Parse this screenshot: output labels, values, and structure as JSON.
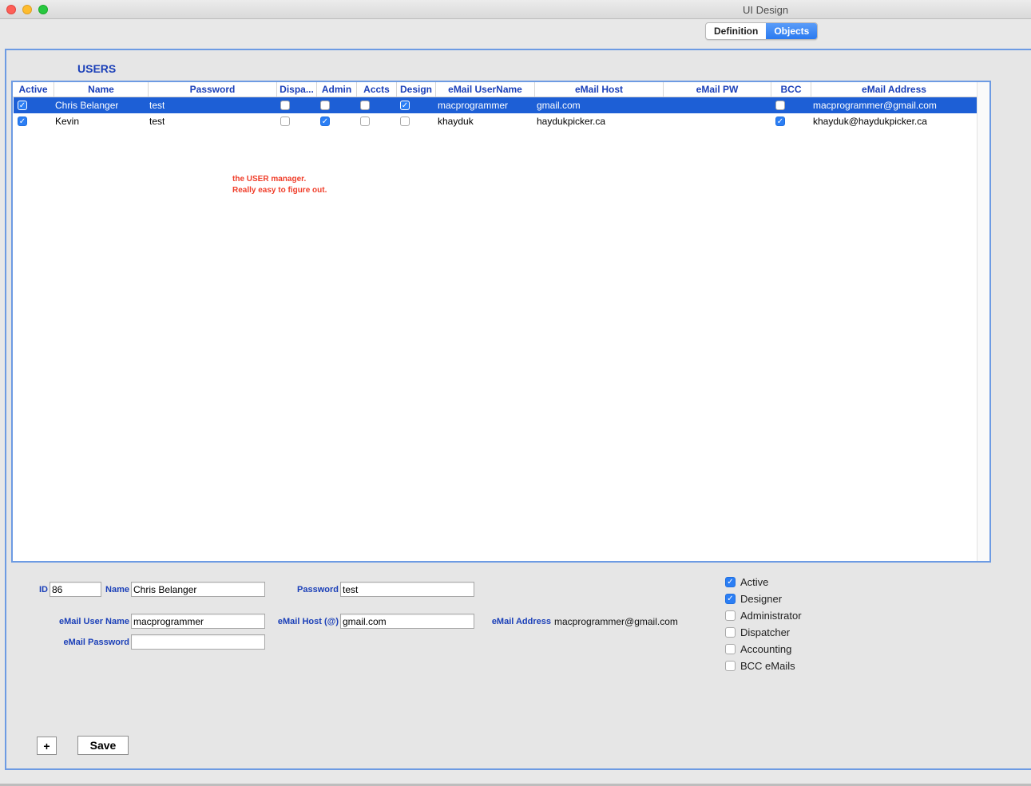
{
  "window": {
    "title": "UI Design"
  },
  "tabs": [
    {
      "label": "Definition",
      "selected": false
    },
    {
      "label": "Objects",
      "selected": true
    }
  ],
  "heading": "USERS",
  "table": {
    "columns": [
      "Active",
      "Name",
      "Password",
      "Dispa...",
      "Admin",
      "Accts",
      "Design",
      "eMail UserName",
      "eMail Host",
      "eMail PW",
      "BCC",
      "eMail Address"
    ],
    "rows": [
      {
        "active": true,
        "name": "Chris Belanger",
        "password": "test",
        "dispatch": false,
        "admin": false,
        "accts": false,
        "design": true,
        "email_user": "macprogrammer",
        "email_host": "gmail.com",
        "email_pw": "",
        "bcc": false,
        "email_address": "macprogrammer@gmail.com",
        "selected": true
      },
      {
        "active": true,
        "name": "Kevin",
        "password": "test",
        "dispatch": false,
        "admin": true,
        "accts": false,
        "design": false,
        "email_user": "khayduk",
        "email_host": "haydukpicker.ca",
        "email_pw": "",
        "bcc": true,
        "email_address": "khayduk@haydukpicker.ca",
        "selected": false
      }
    ]
  },
  "note": {
    "line1": "the USER manager.",
    "line2": "Really easy to figure out."
  },
  "form": {
    "id_label": "ID",
    "id_value": "86",
    "name_label": "Name",
    "name_value": "Chris Belanger",
    "password_label": "Password",
    "password_value": "test",
    "email_user_label": "eMail User Name",
    "email_user_value": "macprogrammer",
    "email_host_label": "eMail Host (@)",
    "email_host_value": "gmail.com",
    "email_address_label": "eMail Address",
    "email_address_value": "macprogrammer@gmail.com",
    "email_password_label": "eMail Password",
    "email_password_value": ""
  },
  "options": [
    {
      "label": "Active",
      "checked": true
    },
    {
      "label": "Designer",
      "checked": true
    },
    {
      "label": "Administrator",
      "checked": false
    },
    {
      "label": "Dispatcher",
      "checked": false
    },
    {
      "label": "Accounting",
      "checked": false
    },
    {
      "label": "BCC eMails",
      "checked": false
    }
  ],
  "buttons": {
    "add": "+",
    "save": "Save"
  },
  "colors": {
    "accent": "#2b7ef4",
    "label_blue": "#1a3fb8",
    "selection": "#1d5fd6",
    "note_red": "#f03e2a",
    "border_blue": "#6d9be3"
  }
}
